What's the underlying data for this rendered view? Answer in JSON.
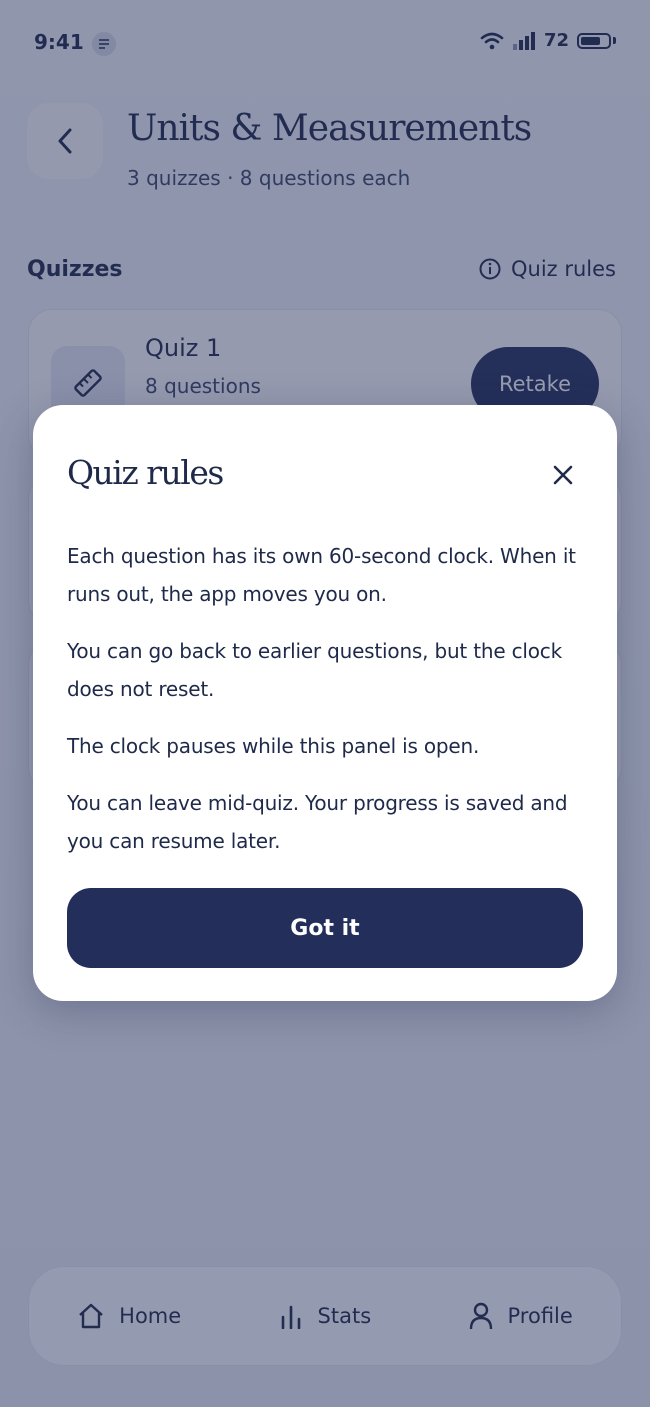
{
  "status": {
    "time": "9:41",
    "battery": "72",
    "battery_level": 0.72
  },
  "header": {
    "title": "Units & Measurements",
    "subtitle": "3 quizzes · 8 questions each"
  },
  "section": {
    "title": "Quizzes",
    "rules_link": "Quiz rules"
  },
  "quizzes": [
    {
      "name": "Quiz 1",
      "count": "8 questions",
      "action": "Retake"
    },
    {
      "name": "",
      "count": "",
      "action": ""
    },
    {
      "name": "",
      "count": "",
      "action": ""
    }
  ],
  "modal": {
    "title": "Quiz rules",
    "rules": [
      "Each question has its own 60-second clock. When it runs out, the app moves you on.",
      "You can go back to earlier questions, but the clock does not reset.",
      "The clock pauses while this panel is open.",
      "You can leave mid-quiz. Your progress is saved and you can resume later."
    ],
    "button": "Got it"
  },
  "nav": [
    {
      "label": "Home",
      "icon": "home-icon"
    },
    {
      "label": "Stats",
      "icon": "stats-icon"
    },
    {
      "label": "Profile",
      "icon": "profile-icon"
    }
  ],
  "colors": {
    "primary": "#232f5a",
    "text": "#1f2a4a",
    "overlay": "rgba(38,48,90,0.48)"
  }
}
